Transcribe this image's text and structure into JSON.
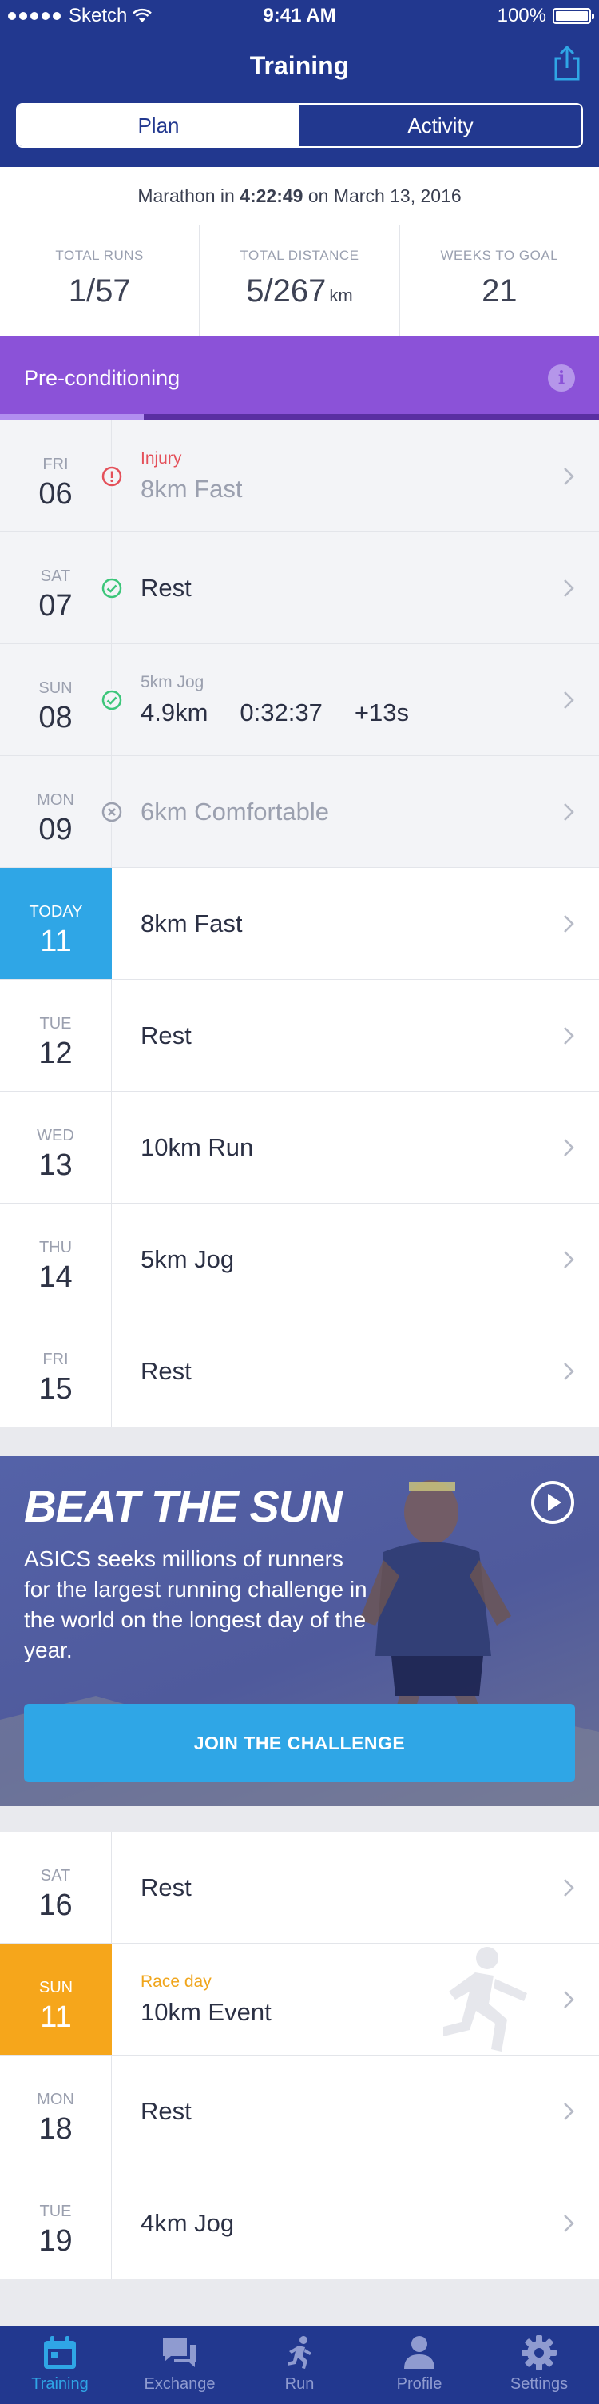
{
  "status_bar": {
    "carrier": "Sketch",
    "time": "9:41 AM",
    "battery": "100%"
  },
  "nav": {
    "title": "Training",
    "share_icon": "share-icon"
  },
  "segments": {
    "plan": "Plan",
    "activity": "Activity",
    "selected": "Plan"
  },
  "goal": {
    "prefix": "Marathon in ",
    "time": "4:22:49",
    "suffix": " on March 13, 2016"
  },
  "stats": [
    {
      "label": "TOTAL RUNS",
      "value": "1/57",
      "unit": ""
    },
    {
      "label": "TOTAL DISTANCE",
      "value": "5/267",
      "unit": "km"
    },
    {
      "label": "WEEKS TO GOAL",
      "value": "21",
      "unit": ""
    }
  ],
  "phase": {
    "title": "Pre-conditioning",
    "progress": 0.24,
    "info_icon": "info-icon"
  },
  "days_week1": [
    {
      "day": "FRI",
      "date": "06",
      "status": "injury",
      "subtitle": "Injury",
      "title": "8km Fast"
    },
    {
      "day": "SAT",
      "date": "07",
      "status": "done",
      "subtitle": "",
      "title": "Rest"
    },
    {
      "day": "SUN",
      "date": "08",
      "status": "done",
      "subtitle": "5km Jog",
      "distance": "4.9km",
      "duration": "0:32:37",
      "delta": "+13s"
    },
    {
      "day": "MON",
      "date": "09",
      "status": "skipped",
      "subtitle": "",
      "title": "6km Comfortable"
    },
    {
      "day": "TODAY",
      "date": "11",
      "status": "today",
      "subtitle": "",
      "title": "8km Fast"
    },
    {
      "day": "TUE",
      "date": "12",
      "status": "upcoming",
      "subtitle": "",
      "title": "Rest"
    },
    {
      "day": "WED",
      "date": "13",
      "status": "upcoming",
      "subtitle": "",
      "title": "10km Run"
    },
    {
      "day": "THU",
      "date": "14",
      "status": "upcoming",
      "subtitle": "",
      "title": "5km Jog"
    },
    {
      "day": "FRI",
      "date": "15",
      "status": "upcoming",
      "subtitle": "",
      "title": "Rest"
    }
  ],
  "promo": {
    "title": "BEAT THE SUN",
    "text": "ASICS seeks millions of runners for the largest running challenge in the world on the longest day of the year.",
    "cta": "JOIN THE CHALLENGE",
    "play_icon": "play-icon"
  },
  "days_week2": [
    {
      "day": "SAT",
      "date": "16",
      "status": "upcoming",
      "subtitle": "",
      "title": "Rest"
    },
    {
      "day": "SUN",
      "date": "11",
      "status": "race",
      "subtitle": "Race day",
      "title": "10km Event"
    },
    {
      "day": "MON",
      "date": "18",
      "status": "upcoming",
      "subtitle": "",
      "title": "Rest"
    },
    {
      "day": "TUE",
      "date": "19",
      "status": "upcoming",
      "subtitle": "",
      "title": "4km Jog"
    }
  ],
  "tabs": [
    {
      "label": "Training",
      "icon": "calendar-icon",
      "active": true
    },
    {
      "label": "Exchange",
      "icon": "chat-icon",
      "active": false
    },
    {
      "label": "Run",
      "icon": "runner-icon",
      "active": false
    },
    {
      "label": "Profile",
      "icon": "person-icon",
      "active": false
    },
    {
      "label": "Settings",
      "icon": "gear-icon",
      "active": false
    }
  ],
  "colors": {
    "navy": "#22388f",
    "accent_blue": "#2fa6e6",
    "purple": "#8b52d8",
    "race_orange": "#f6a61b",
    "injury_red": "#e4505a",
    "done_green": "#3cc67a"
  }
}
